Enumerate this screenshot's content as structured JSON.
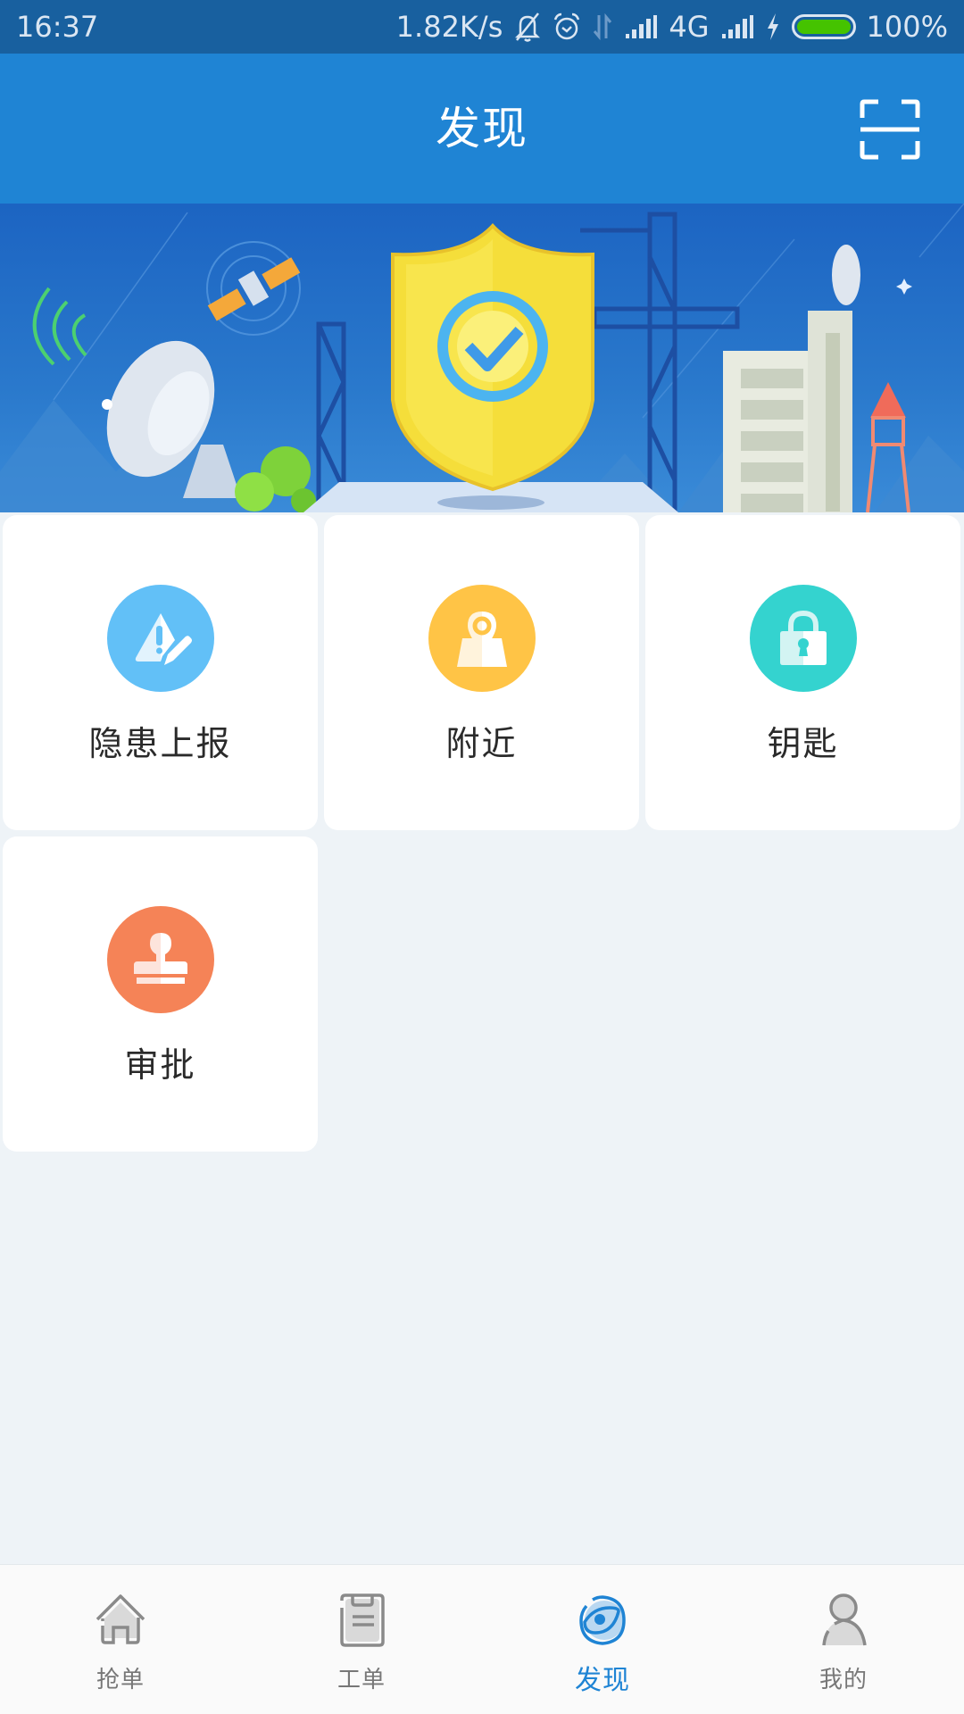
{
  "status_bar": {
    "time": "16:37",
    "net_speed": "1.82K/s",
    "network_type": "4G",
    "battery": "100%",
    "battery_level": 1.0,
    "icons": [
      "bell-off-icon",
      "alarm-icon",
      "data-arrows-icon",
      "signal-icon",
      "signal-icon",
      "charging-icon",
      "battery-icon"
    ]
  },
  "header": {
    "title": "发现",
    "scan_icon": "scan-icon"
  },
  "banner": {
    "description": "security shield illustration"
  },
  "features": [
    {
      "label": "隐患上报",
      "icon": "warning-edit-icon",
      "color": "#62c0f7"
    },
    {
      "label": "附近",
      "icon": "map-pin-icon",
      "color": "#ffc446"
    },
    {
      "label": "钥匙",
      "icon": "lock-icon",
      "color": "#34d3cf"
    },
    {
      "label": "审批",
      "icon": "stamp-icon",
      "color": "#f58357"
    }
  ],
  "bottom_nav": {
    "items": [
      {
        "label": "抢单",
        "icon": "home-icon",
        "active": false
      },
      {
        "label": "工单",
        "icon": "clipboard-icon",
        "active": false
      },
      {
        "label": "发现",
        "icon": "eye-icon",
        "active": true
      },
      {
        "label": "我的",
        "icon": "user-icon",
        "active": false
      }
    ],
    "active_color": "#1f84d4",
    "inactive_color": "#777777"
  }
}
